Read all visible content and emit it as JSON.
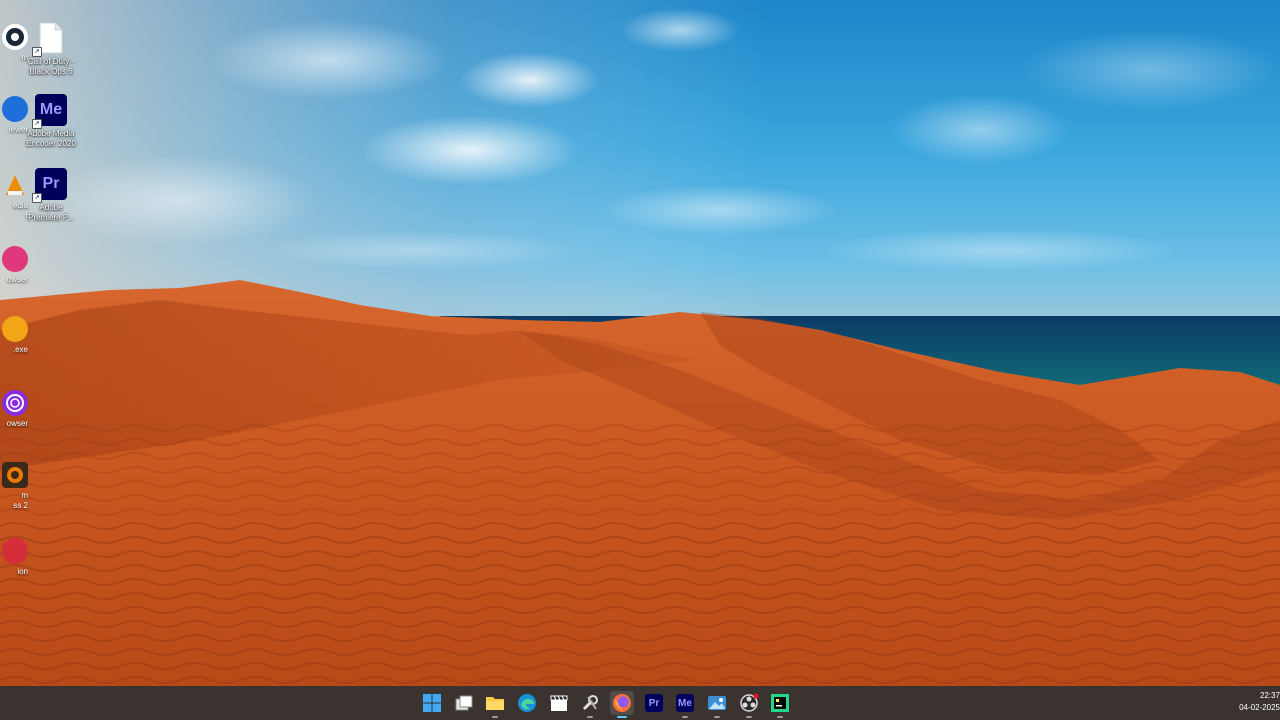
{
  "desktop": {
    "icons": [
      {
        "label": "Call of Duty -\nBlack Ops 6"
      },
      {
        "label": "Adobe Media\nEncoder 2020",
        "glyph": "Me"
      },
      {
        "label": "Adobe\nPremiere P...",
        "glyph": "Pr"
      }
    ],
    "partial_icons": [
      {
        "label": "m"
      },
      {
        "label": "iewer"
      },
      {
        "label": "edia\nr"
      },
      {
        "label": "owser"
      },
      {
        "label": ".exe"
      },
      {
        "label": "owser"
      },
      {
        "label": "m\nss 2"
      },
      {
        "label": "ion"
      }
    ]
  },
  "taskbar": {
    "apps": [
      {
        "name": "start-button",
        "icon": "windows-logo"
      },
      {
        "name": "task-view-button",
        "icon": "task-view"
      },
      {
        "name": "file-explorer",
        "icon": "folder"
      },
      {
        "name": "edge",
        "icon": "edge"
      },
      {
        "name": "clapperboard-app",
        "icon": "clapperboard"
      },
      {
        "name": "tools-app",
        "icon": "tools"
      },
      {
        "name": "firefox",
        "icon": "firefox",
        "active": true
      },
      {
        "name": "premiere-pro",
        "icon": "premiere",
        "glyph": "Pr"
      },
      {
        "name": "media-encoder",
        "icon": "media-encoder",
        "glyph": "Me"
      },
      {
        "name": "photos",
        "icon": "photos"
      },
      {
        "name": "obs",
        "icon": "obs"
      },
      {
        "name": "pycharm",
        "icon": "pycharm"
      }
    ],
    "clock": {
      "time": "22:37",
      "date": "04-02-2025"
    }
  },
  "colors": {
    "taskbar_bg": "#3a3330",
    "accent": "#60cdff",
    "premiere": "#00005b",
    "premiere_text": "#9999ff"
  }
}
